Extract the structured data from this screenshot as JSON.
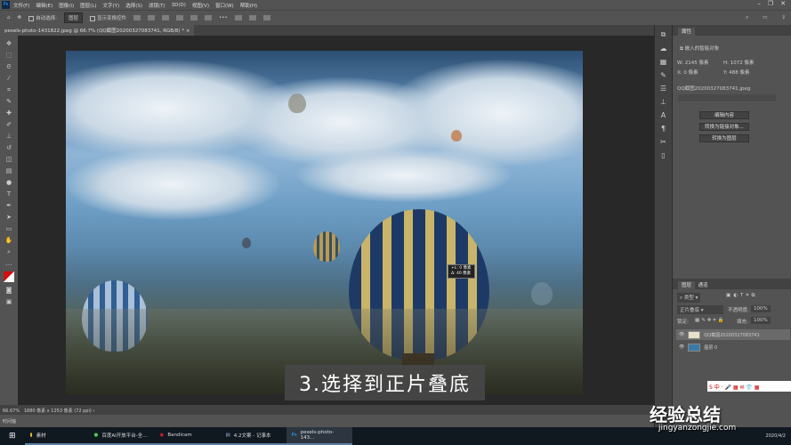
{
  "menubar": {
    "logo": "Ps",
    "items": [
      "文件(F)",
      "编辑(E)",
      "图像(I)",
      "图层(L)",
      "文字(Y)",
      "选择(S)",
      "滤镜(T)",
      "3D(D)",
      "视图(V)",
      "窗口(W)",
      "帮助(H)"
    ]
  },
  "options": {
    "auto_select": "自动选择:",
    "target": "图层",
    "show_transform": "显示变换控件"
  },
  "document_tab": "pexels-photo-1431822.jpeg @ 66.7% (QQ截图20200327083741, RGB/8) *",
  "caption": "3.选择到正片叠底",
  "tooltip": {
    "line1": "+L: 0 像素",
    "line2": "Δ: 40 像素"
  },
  "status": {
    "zoom": "66.67%",
    "size": "1880 像素 x 1253 像素 (72 ppi)",
    "timeline": "时间轴"
  },
  "properties": {
    "tab": "属性",
    "type": "嵌入的智能对象",
    "w": "W: 2145 像素",
    "h": "H: 1072 像素",
    "x": "X: 0 像素",
    "y": "Y: 488 像素",
    "file": "QQ截图20200327083741.jpeg",
    "buttons": [
      "编辑内容",
      "转换为链接对象...",
      "转换为图层"
    ]
  },
  "layers": {
    "tabs": [
      "图层",
      "通道"
    ],
    "filter": "类型",
    "blend_mode": "正片叠底",
    "opacity_label": "不透明度:",
    "opacity": "100%",
    "lock_label": "锁定:",
    "fill_label": "填充:",
    "fill": "100%",
    "items": [
      "QQ截图20200327083741",
      "图层 0"
    ]
  },
  "taskbar": {
    "items": [
      "素材",
      "百度AI开放平台-全...",
      "Bandicam",
      "4.2文案 - 记事本",
      "pexels-photo-143..."
    ]
  },
  "watermark": {
    "main": "经验总结",
    "sub": "jingyanzongjie.com"
  },
  "clock": "2020/4/2"
}
